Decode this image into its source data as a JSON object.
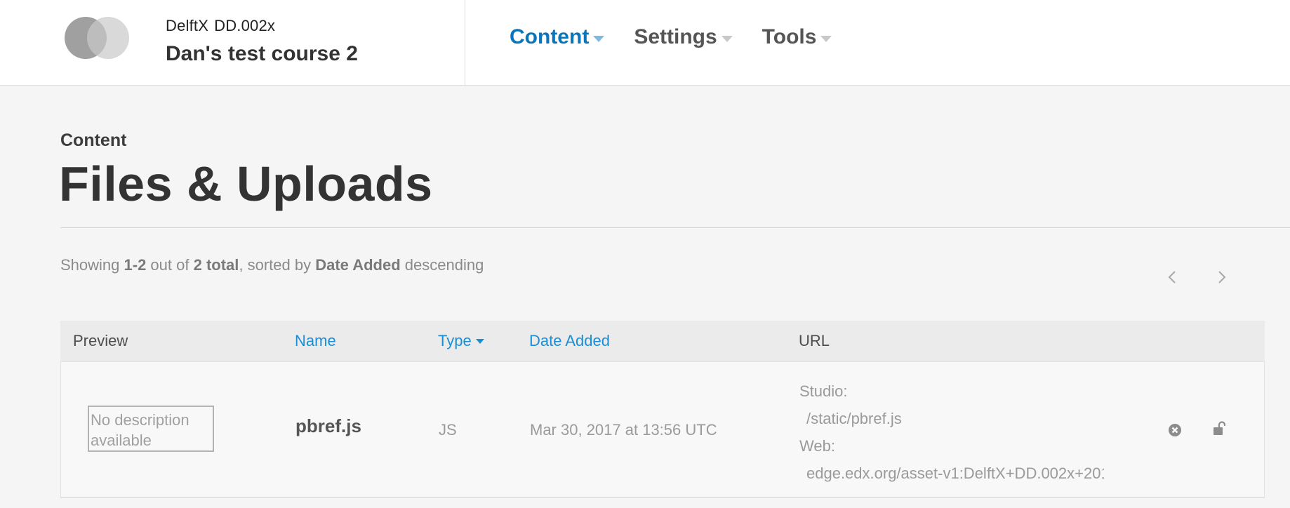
{
  "header": {
    "org": "DelftX",
    "course_number": "DD.002x",
    "course_title": "Dan's test course 2",
    "nav": [
      {
        "label": "Content",
        "active": true
      },
      {
        "label": "Settings",
        "active": false
      },
      {
        "label": "Tools",
        "active": false
      }
    ]
  },
  "page": {
    "subtitle": "Content",
    "title": "Files & Uploads"
  },
  "summary": {
    "prefix": "Showing ",
    "range": "1-2",
    "mid1": " out of ",
    "total": "2 total",
    "mid2": ", sorted by ",
    "sort_field": "Date Added",
    "suffix": " descending"
  },
  "pager": {
    "prev_icon": "chevron-left-icon",
    "next_icon": "chevron-right-icon"
  },
  "table": {
    "headers": {
      "preview": "Preview",
      "name": "Name",
      "type": "Type",
      "date": "Date Added",
      "url": "URL"
    },
    "rows": [
      {
        "preview": "No description available",
        "name": "pbref.js",
        "type": "JS",
        "date": "Mar 30, 2017 at 13:56 UTC",
        "studio_label": "Studio:",
        "studio_url": "/static/pbref.js",
        "web_label": "Web:",
        "web_url": "edge.edx.org/asset-v1:DelftX+DD.002x+201"
      }
    ]
  },
  "colors": {
    "accent": "#0b75bb",
    "link": "#1a8fd6",
    "background": "#f5f5f5"
  }
}
